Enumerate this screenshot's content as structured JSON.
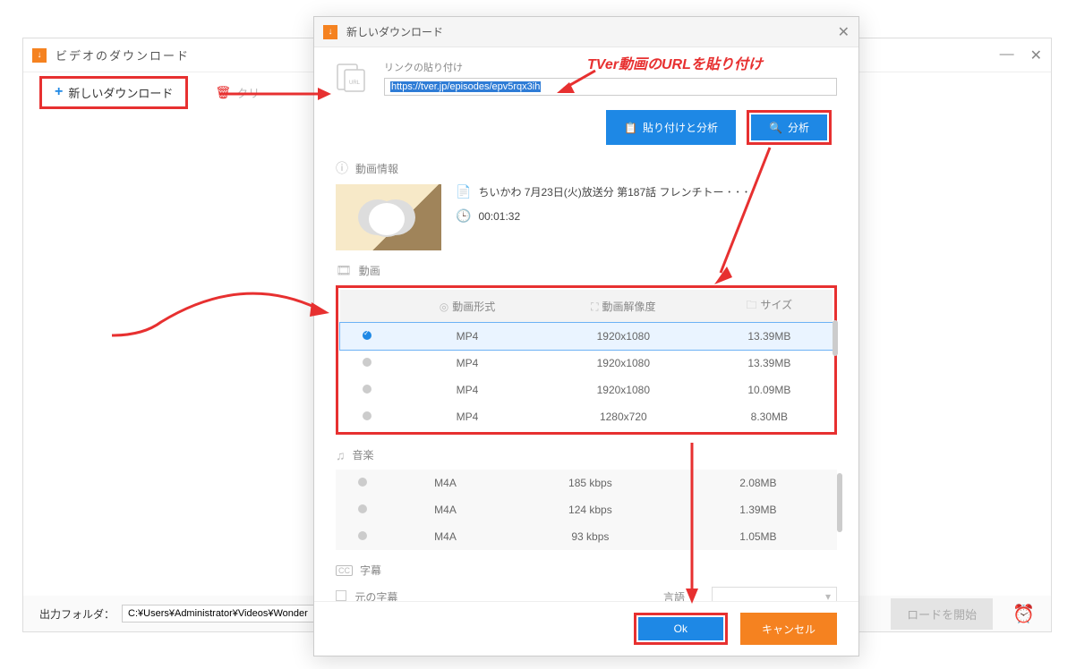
{
  "parent": {
    "title": "ビデオのダウンロード",
    "new_download": "新しいダウンロード",
    "clear": "クリ",
    "output_label": "出力フォルダ：",
    "output_path": "C:¥Users¥Administrator¥Videos¥Wonder",
    "start_download": "ロードを開始"
  },
  "modal": {
    "title": "新しいダウンロード",
    "url_label": "リンクの貼り付け",
    "url_value": "https://tver.jp/episodes/epv5rqx3ih",
    "paste_analyze": "貼り付けと分析",
    "analyze": "分析",
    "info_header": "動画情報",
    "video_title": "ちいかわ 7月23日(火)放送分 第187話 フレンチトー ･ ･ ･",
    "duration": "00:01:32",
    "video_header": "動画",
    "format_col": "動画形式",
    "resolution_col": "動画解像度",
    "size_col": "サイズ",
    "video_rows": [
      {
        "fmt": "MP4",
        "res": "1920x1080",
        "size": "13.39MB",
        "sel": true
      },
      {
        "fmt": "MP4",
        "res": "1920x1080",
        "size": "13.39MB",
        "sel": false
      },
      {
        "fmt": "MP4",
        "res": "1920x1080",
        "size": "10.09MB",
        "sel": false
      },
      {
        "fmt": "MP4",
        "res": "1280x720",
        "size": "8.30MB",
        "sel": false
      }
    ],
    "audio_header": "音楽",
    "audio_rows": [
      {
        "fmt": "M4A",
        "res": "185 kbps",
        "size": "2.08MB"
      },
      {
        "fmt": "M4A",
        "res": "124 kbps",
        "size": "1.39MB"
      },
      {
        "fmt": "M4A",
        "res": "93 kbps",
        "size": "1.05MB"
      }
    ],
    "subtitle_header": "字幕",
    "original_subtitle": "元の字幕",
    "language_label": "言語",
    "ok": "Ok",
    "cancel": "キャンセル"
  },
  "annotation": {
    "text": "TVer動画のURLを貼り付け"
  }
}
